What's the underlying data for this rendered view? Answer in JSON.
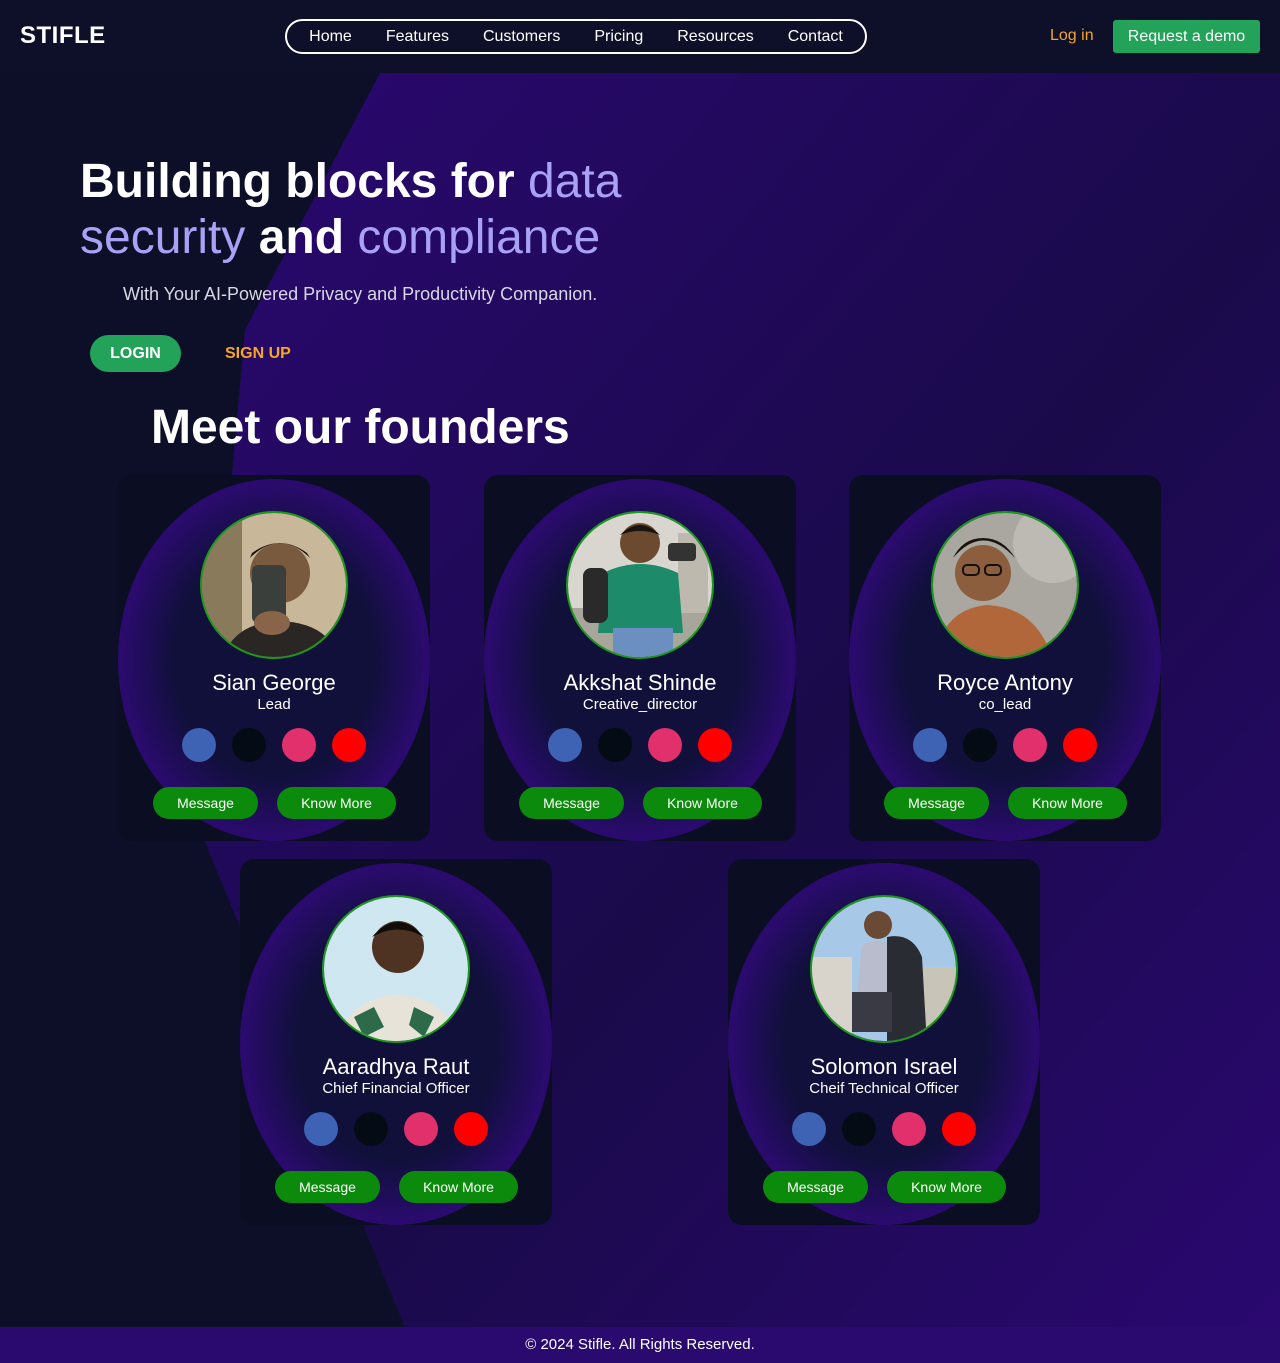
{
  "header": {
    "logo": "STIFLE",
    "nav": [
      "Home",
      "Features",
      "Customers",
      "Pricing",
      "Resources",
      "Contact"
    ],
    "login_link": "Log in",
    "demo_button": "Request a demo"
  },
  "hero": {
    "title_part1": "Building blocks for ",
    "title_highlight1": "data security",
    "title_part2": " and ",
    "title_highlight2": "compliance",
    "subtitle": "With Your AI-Powered Privacy and Productivity Companion.",
    "login_button": "LOGIN",
    "signup_link": "SIGN UP"
  },
  "founders": {
    "title": "Meet our founders",
    "message_label": "Message",
    "more_label": "Know More",
    "people": [
      {
        "name": "Sian George",
        "role": "Lead"
      },
      {
        "name": "Akkshat Shinde",
        "role": "Creative_director"
      },
      {
        "name": "Royce Antony",
        "role": "co_lead"
      },
      {
        "name": "Aaradhya Raut",
        "role": "Chief Financial Officer"
      },
      {
        "name": "Solomon Israel",
        "role": "Cheif Technical Officer"
      }
    ]
  },
  "footer": {
    "text": "© 2024 Stifle. All Rights Reserved."
  },
  "colors": {
    "accent_green": "#23a35a",
    "accent_orange": "#f5a623",
    "highlight_purple": "#a9a1f5",
    "button_green": "#0b8a0b"
  }
}
